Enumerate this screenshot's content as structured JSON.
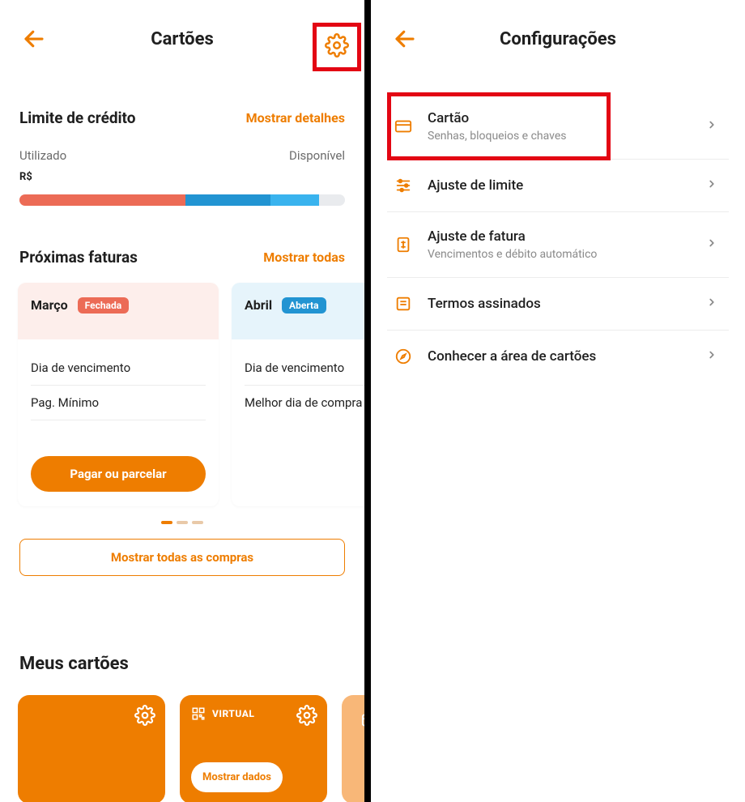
{
  "left": {
    "header_title": "Cartões",
    "limit": {
      "title": "Limite de crédito",
      "show_details": "Mostrar detalhes",
      "used_label": "Utilizado",
      "available_label": "Disponível",
      "currency": "R$"
    },
    "invoices": {
      "title": "Próximas faturas",
      "show_all": "Mostrar todas",
      "cards": [
        {
          "month": "Março",
          "badge": "Fechada",
          "due_label": "Dia de vencimento",
          "line2": "Pag. Mínimo",
          "pay_btn": "Pagar ou parcelar"
        },
        {
          "month": "Abril",
          "badge": "Aberta",
          "due_label": "Dia de vencimento",
          "line2": "Melhor dia de compra"
        }
      ],
      "show_purchases": "Mostrar todas as compras"
    },
    "my_cards": {
      "title": "Meus cartões",
      "virtual_label": "VIRTUAL",
      "show_data": "Mostrar dados"
    }
  },
  "right": {
    "header_title": "Configurações",
    "items": [
      {
        "title": "Cartão",
        "subtitle": "Senhas, bloqueios e chaves"
      },
      {
        "title": "Ajuste de limite",
        "subtitle": ""
      },
      {
        "title": "Ajuste de fatura",
        "subtitle": "Vencimentos e débito automático"
      },
      {
        "title": "Termos assinados",
        "subtitle": ""
      },
      {
        "title": "Conhecer a área de cartões",
        "subtitle": ""
      }
    ]
  }
}
